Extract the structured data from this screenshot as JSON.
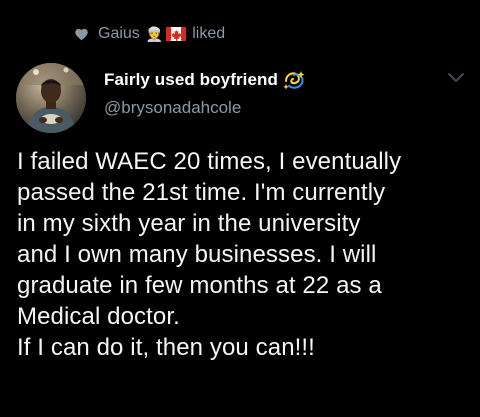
{
  "social_context": {
    "user": "Gaius",
    "emoji_1": "👳",
    "emoji_2_icon": "canada-flag-icon",
    "action": "liked",
    "heart_icon": "heart-icon"
  },
  "author": {
    "display_name": "Fairly used boyfriend",
    "name_emoji_icon": "dizzy-icon",
    "username": "@brysonadahcole",
    "avatar_icon": "avatar"
  },
  "menu_icon": "chevron-down-icon",
  "tweet": {
    "text": "I failed WAEC 20 times, I eventually\npassed the 21st time. I'm currently\nin my sixth year in the university\nand I own many businesses. I will\ngraduate in few months at 22 as a\nMedical doctor.\nIf I can do it, then you can!!!"
  },
  "colors": {
    "background": "#000000",
    "secondary_text": "#8b98a5",
    "primary_text": "#f5f5f5"
  }
}
